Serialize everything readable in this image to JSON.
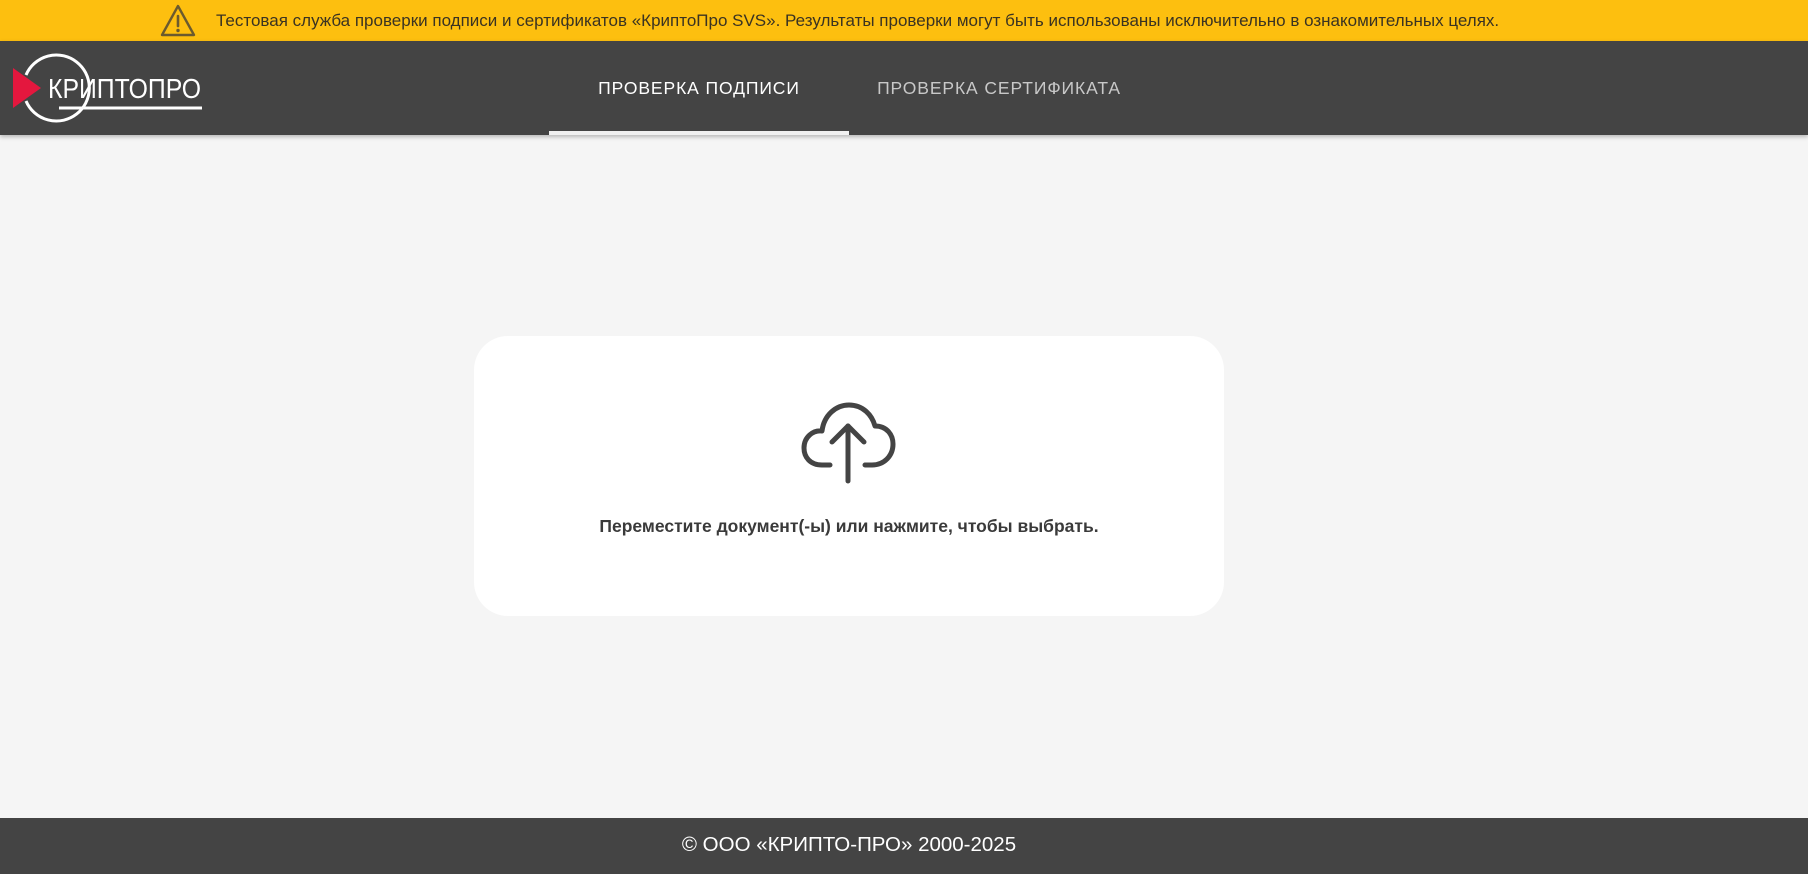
{
  "banner": {
    "icon": "warning-triangle-icon",
    "text": "Тестовая служба проверки подписи и сертификатов «КриптоПро SVS». Результаты проверки могут быть использованы исключительно в ознакомительных целях.",
    "background_color": "#fdbf0f"
  },
  "header": {
    "logo_text": "КРИПТОПРО",
    "background_color": "#444444",
    "tabs": [
      {
        "label": "ПРОВЕРКА ПОДПИСИ",
        "active": true
      },
      {
        "label": "ПРОВЕРКА СЕРТИФИКАТА",
        "active": false
      }
    ]
  },
  "upload": {
    "icon": "cloud-upload-icon",
    "text": "Переместите документ(-ы) или нажмите, чтобы выбрать."
  },
  "footer": {
    "text": "© ООО «КРИПТО-ПРО» 2000-2025"
  },
  "colors": {
    "page_background": "#f5f5f5",
    "logo_accent": "#e4173e"
  }
}
